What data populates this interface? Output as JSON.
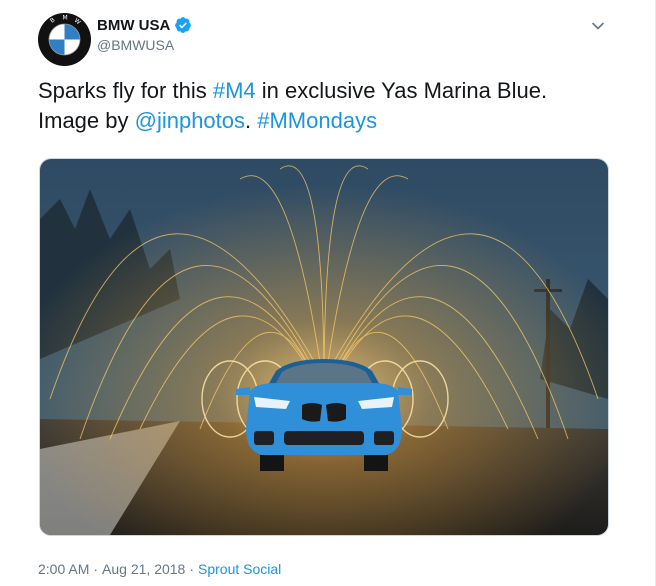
{
  "author": {
    "name": "BMW USA",
    "handle": "@BMWUSA",
    "avatar_icon": "bmw-roundel-logo",
    "verified_icon": "verified-badge-icon",
    "accent": "#1da1f2"
  },
  "tweet": {
    "text_1": "Sparks fly for this ",
    "hashtag_1": "#M4",
    "text_2": " in exclusive Yas Marina Blue.",
    "text_3": "Image by ",
    "mention_1": "@jinphotos",
    "text_4": ". ",
    "hashtag_2": "#MMondays"
  },
  "media": {
    "description_icon": "photo-blue-bmw-m4-steel-wool-sparks"
  },
  "meta": {
    "time": "2:00 AM",
    "sep_1": "·",
    "date": "Aug 21, 2018",
    "sep_2": "·",
    "source": "Sprout Social"
  },
  "colors": {
    "link": "#1b95e0",
    "muted": "#657786",
    "text": "#14171a",
    "car": "#2f8fd8"
  }
}
